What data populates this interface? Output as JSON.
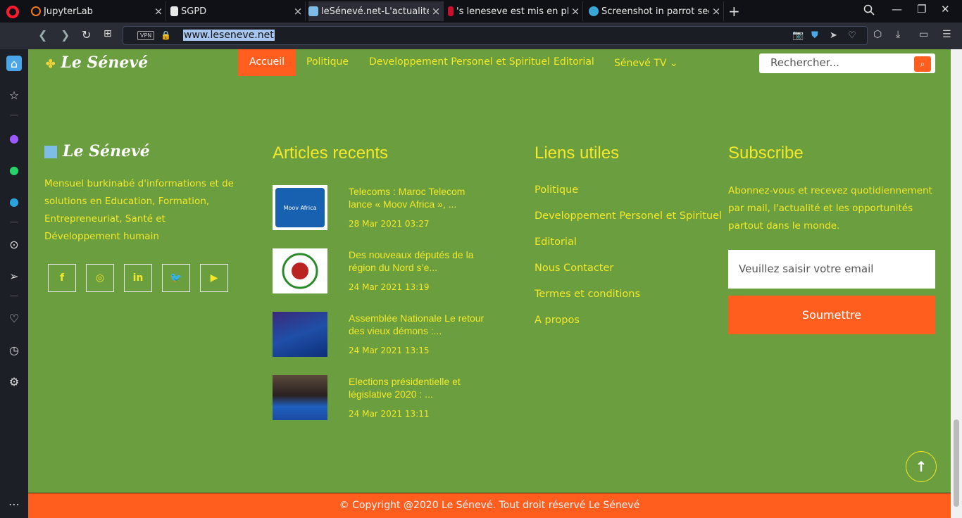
{
  "browser": {
    "tabs": [
      {
        "title": "JupyterLab",
        "close": "×"
      },
      {
        "title": "SGPD",
        "close": "×"
      },
      {
        "title": "leSénevé.net-L'actualité",
        "close": "×"
      },
      {
        "title": "'s leneseve est mis en pl",
        "close": "×"
      },
      {
        "title": "Screenshot in parrot sec",
        "close": "×"
      }
    ],
    "new_tab": "+",
    "vpn_label": "VPN",
    "url": "www.leseneve.net"
  },
  "site": {
    "logo_text": "Le Sénevé",
    "nav": [
      {
        "label": "Accueil"
      },
      {
        "label": "Politique"
      },
      {
        "label": "Developpement Personel et Spirituel"
      },
      {
        "label": "Editorial"
      },
      {
        "label": "Sénevé TV ⌄"
      }
    ],
    "search_placeholder": "Rechercher...",
    "colors": {
      "background": "#6a9e3f",
      "accent": "#ff5e1f",
      "text": "#f3e82a"
    }
  },
  "footer": {
    "about": {
      "logo_text": "Le Sénevé",
      "description": "Mensuel burkinabé d'informations et de solutions en Education, Formation, Entrepreneuriat, Santé et Développement humain",
      "social": [
        "f",
        "◎",
        "in",
        "🐦",
        "▶"
      ]
    },
    "articles": {
      "heading": "Articles recents",
      "items": [
        {
          "title": "Telecoms : Maroc Telecom lance « Moov Africa », ...",
          "date": "28 Mar 2021 03:27",
          "thumb_text": "Moov Africa"
        },
        {
          "title": "Des nouveaux députés de la région du Nord s’e...",
          "date": "24 Mar 2021 13:19"
        },
        {
          "title": "Assemblée Nationale Le retour des vieux démons :...",
          "date": "24 Mar 2021 13:15"
        },
        {
          "title": "Elections présidentielle et législative 2020 : ...",
          "date": "24 Mar 2021 13:11"
        }
      ]
    },
    "links": {
      "heading": "Liens utiles",
      "items": [
        "Politique",
        "Developpement Personel et Spirituel",
        "Editorial",
        "Nous Contacter",
        "Termes et conditions",
        "A propos"
      ]
    },
    "subscribe": {
      "heading": "Subscribe",
      "text": "Abonnez-vous et recevez quotidiennement par mail, l'actualité et les opportunités partout dans le monde.",
      "email_placeholder": "Veuillez saisir votre email",
      "button": "Soumettre"
    },
    "copyright": "© Copyright @2020 Le Sénevé. Tout droit réservé Le Sénevé"
  },
  "sidebar_icons": [
    "home-icon",
    "bookmarks-icon",
    "messenger-icon",
    "whatsapp-icon",
    "telegram-icon",
    "player-icon",
    "send-icon",
    "heart-icon",
    "history-icon",
    "settings-icon",
    "more-icon"
  ]
}
